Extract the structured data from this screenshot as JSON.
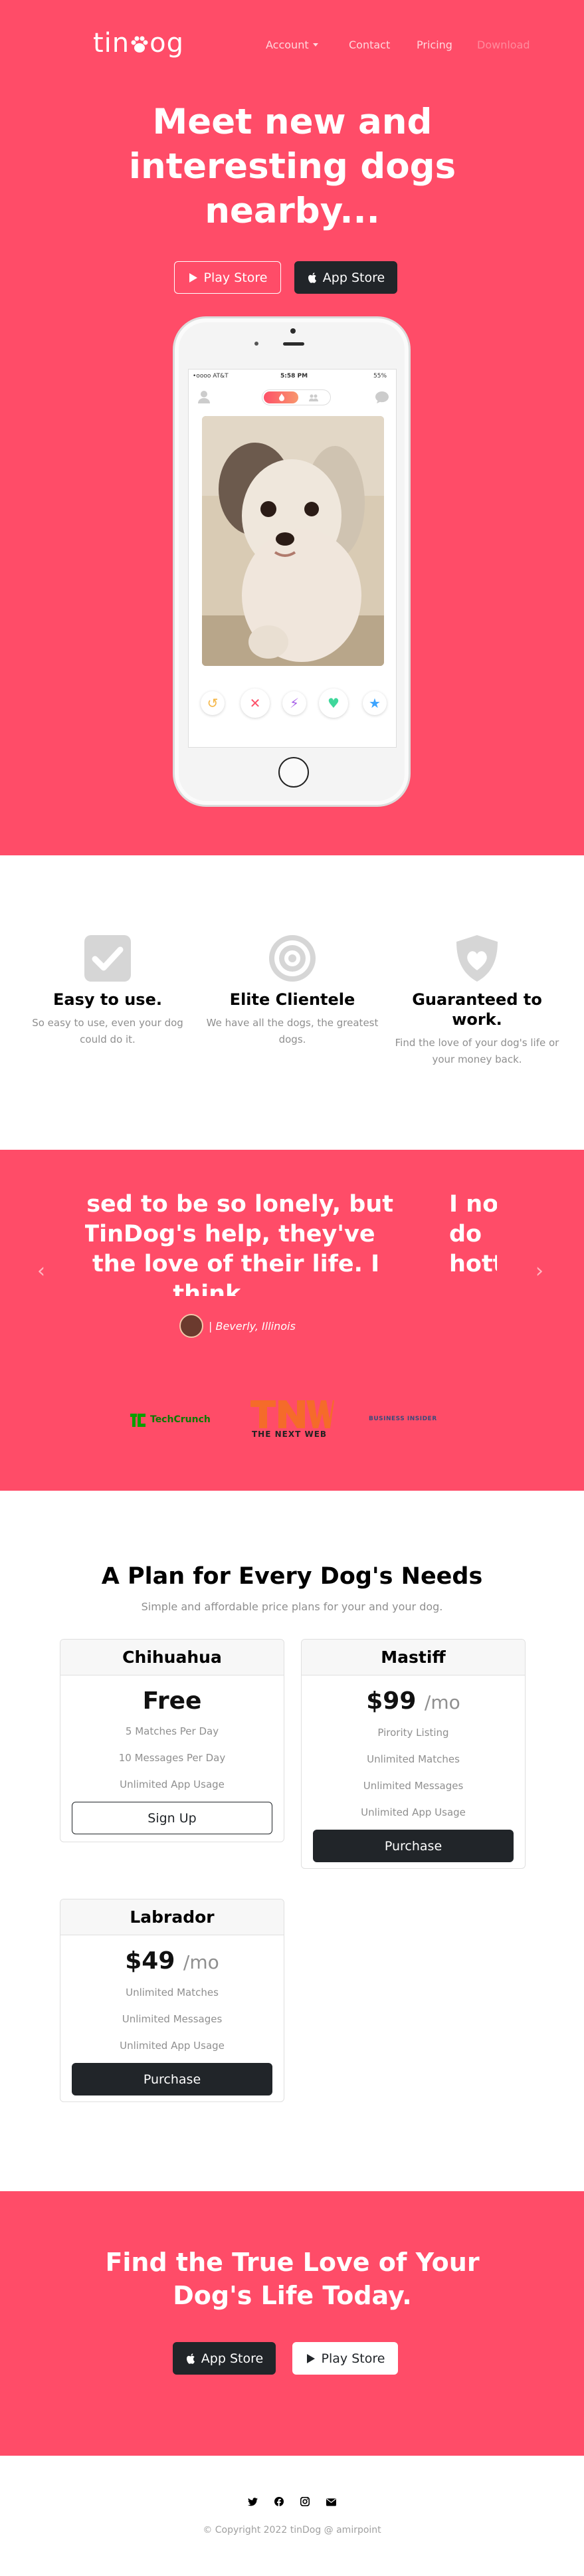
{
  "colors": {
    "brand_pink": "#ff4c68",
    "dark": "#212529",
    "muted": "#8f8f8f"
  },
  "nav": {
    "brand": "tindog",
    "brand_prefix": "tin",
    "brand_suffix": "og",
    "links": [
      {
        "label": "Account",
        "has_caret": true
      },
      {
        "label": "Contact"
      },
      {
        "label": "Pricing"
      },
      {
        "label": "Download",
        "disabled": true
      }
    ]
  },
  "hero": {
    "heading": "Meet new and interesting dogs nearby...",
    "play_store_label": "Play Store",
    "app_store_label": "App Store",
    "phone": {
      "carrier": "•oooo AT&T",
      "time": "5:58 PM",
      "battery": "55%"
    }
  },
  "features": [
    {
      "icon": "check-square-icon",
      "title": "Easy to use.",
      "text": "So easy to use, even your dog could do it."
    },
    {
      "icon": "bullseye-icon",
      "title": "Elite Clientele",
      "text": "We have all the dogs, the greatest dogs."
    },
    {
      "icon": "heart-shield-icon",
      "title": "Guaranteed to work.",
      "text": "Find the love of your dog's life or your money back."
    }
  ],
  "testimonial": {
    "quote_visible": "og used to be so lonely, but\nth TinDog's help, they've\nınd the love of their life. I\nthink.",
    "next_quote_fragment": "I no\ndo\nhott",
    "author": "Beverly, Illinois",
    "press": [
      "TechCrunch",
      "THE NEXT WEB",
      "BUSINESS INSIDER"
    ]
  },
  "pricing": {
    "title": "A Plan for Every Dog's Needs",
    "subtitle": "Simple and affordable price plans for your and your dog.",
    "plans": [
      {
        "name": "Chihuahua",
        "price": "Free",
        "period": "",
        "features": [
          "5 Matches Per Day",
          "10 Messages Per Day",
          "Unlimited App Usage"
        ],
        "cta": "Sign Up"
      },
      {
        "name": "Mastiff",
        "price": "$99",
        "period": "/mo",
        "features": [
          "Pirority Listing",
          "Unlimited Matches",
          "Unlimited Messages",
          "Unlimited App Usage"
        ],
        "cta": "Purchase"
      },
      {
        "name": "Labrador",
        "price": "$49",
        "period": "/mo",
        "features": [
          "Unlimited Matches",
          "Unlimited Messages",
          "Unlimited App Usage"
        ],
        "cta": "Purchase"
      }
    ]
  },
  "cta": {
    "heading": "Find the True Love of Your Dog's Life Today.",
    "app_store_label": "App Store",
    "play_store_label": "Play Store"
  },
  "footer": {
    "social_icons": [
      "twitter-icon",
      "facebook-icon",
      "instagram-icon",
      "envelope-icon"
    ],
    "copyright": "© Copyright 2022 tinDog @ amirpoint"
  }
}
